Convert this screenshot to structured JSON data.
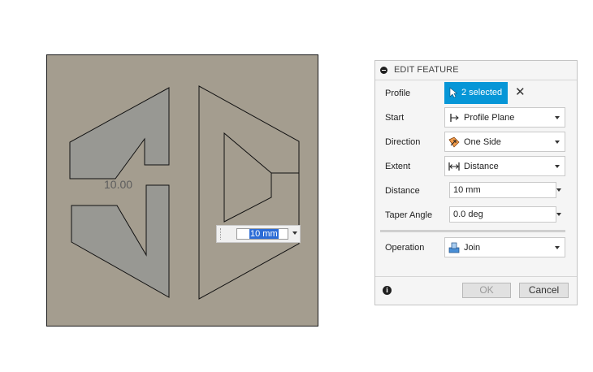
{
  "canvas": {
    "dimension_label": "10.00",
    "inline_value": "10 mm"
  },
  "panel": {
    "title": "EDIT FEATURE",
    "rows": {
      "profile": {
        "label": "Profile",
        "value": "2 selected",
        "clear_icon": "close-icon"
      },
      "start": {
        "label": "Start",
        "value": "Profile Plane",
        "icon": "profile-plane-icon"
      },
      "direction": {
        "label": "Direction",
        "value": "One Side",
        "icon": "one-side-icon"
      },
      "extent": {
        "label": "Extent",
        "value": "Distance",
        "icon": "distance-icon"
      },
      "distance": {
        "label": "Distance",
        "value": "10 mm"
      },
      "taper": {
        "label": "Taper Angle",
        "value": "0.0 deg"
      },
      "operation": {
        "label": "Operation",
        "value": "Join",
        "icon": "join-icon"
      }
    },
    "buttons": {
      "ok": "OK",
      "cancel": "Cancel"
    }
  },
  "colors": {
    "canvas_bg": "#a49d8f",
    "selected_face": "#989893",
    "accent": "#0696d7"
  }
}
